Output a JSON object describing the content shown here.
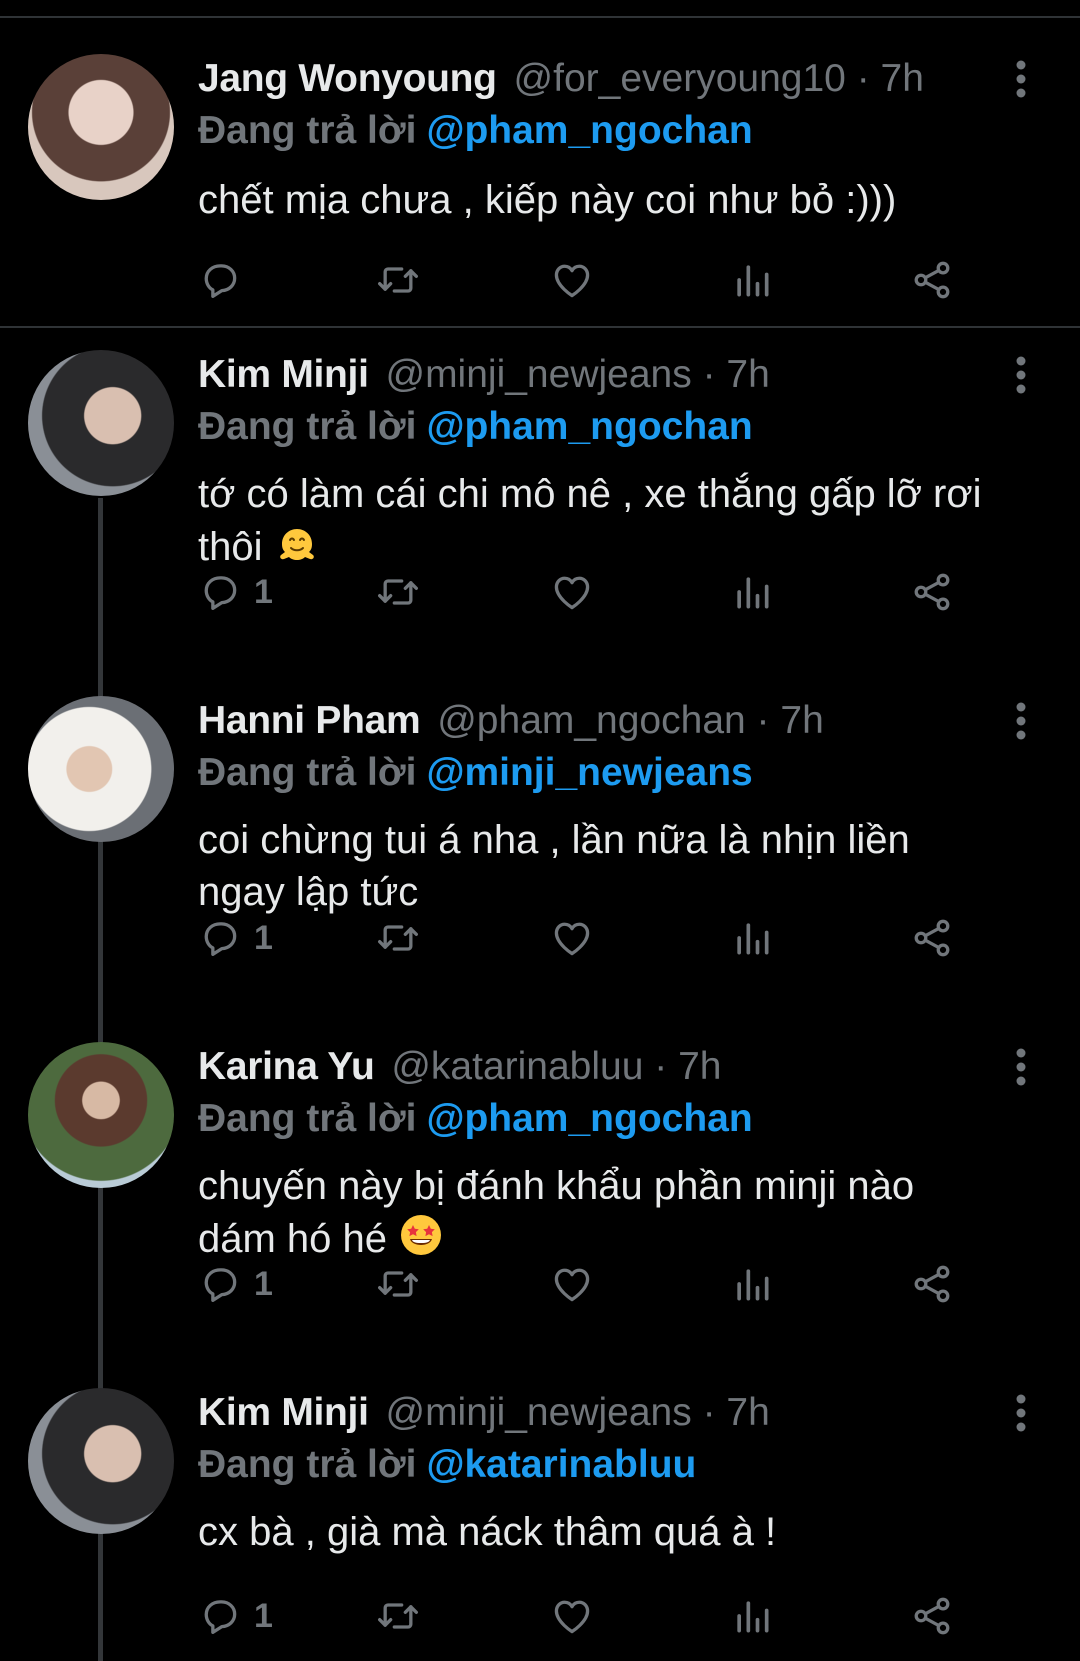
{
  "reply_prefix": "Đang trả lời",
  "colors": {
    "background": "#000000",
    "text": "#e7e9ea",
    "muted": "#71767b",
    "link": "#1d9bf0"
  },
  "tweets": [
    {
      "name": "Jang Wonyoung",
      "handle": "@for_everyoung10",
      "dot": "·",
      "time": "7h",
      "replying_to": "@pham_ngochan",
      "text_lines": [
        "chết mịa chưa , kiếp này coi như bỏ :)))"
      ],
      "emoji": "",
      "reply_count": ""
    },
    {
      "name": "Kim Minji",
      "handle": "@minji_newjeans",
      "dot": "·",
      "time": "7h",
      "replying_to": "@pham_ngochan",
      "text_lines": [
        "tớ có làm cái chi mô nê , xe thắng gấp lỡ rơi",
        "thôi"
      ],
      "emoji": "melting-face-emoji",
      "reply_count": "1"
    },
    {
      "name": "Hanni Pham",
      "handle": "@pham_ngochan",
      "dot": "·",
      "time": "7h",
      "replying_to": "@minji_newjeans",
      "text_lines": [
        "coi chừng tui á nha , lần nữa là nhịn liền",
        "ngay lập tức"
      ],
      "emoji": "",
      "reply_count": "1"
    },
    {
      "name": "Karina Yu",
      "handle": "@katarinabluu",
      "dot": "·",
      "time": "7h",
      "replying_to": "@pham_ngochan",
      "text_lines": [
        "chuyến này bị đánh khẩu phần minji nào",
        "dám hó hé"
      ],
      "emoji": "star-struck-emoji",
      "reply_count": "1"
    },
    {
      "name": "Kim Minji",
      "handle": "@minji_newjeans",
      "dot": "·",
      "time": "7h",
      "replying_to": "@katarinabluu",
      "text_lines": [
        "cx bà , già mà náck thâm quá à !"
      ],
      "emoji": "",
      "reply_count": "1"
    }
  ]
}
